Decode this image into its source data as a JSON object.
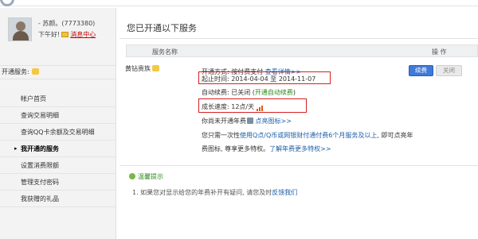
{
  "profile": {
    "username": "- 苏颜。(7773380)",
    "greeting": "下午好!",
    "message_link": "消息中心"
  },
  "sidebar": {
    "services_label": "开通服务:",
    "items": [
      {
        "label": "帐户首页"
      },
      {
        "label": "查询交易明细"
      },
      {
        "label": "查询QQ卡余额及交易明细"
      },
      {
        "label": "我开通的服务",
        "active": true
      },
      {
        "label": "设置消费限额"
      },
      {
        "label": "管理支付密码"
      },
      {
        "label": "我获赠的礼品"
      }
    ]
  },
  "main": {
    "title": "您已开通以下服务",
    "table_headers": {
      "name": "服务名称",
      "action": "操 作"
    },
    "service_name": "黄钻贵族",
    "lines": {
      "pay_method_label": "开通方式: 按付费支付",
      "pay_method_link": "查看详情>>",
      "term_label": "起止时间: 2014-04-04 至 2014-11-07",
      "auto_renew_label": "自动续费: 已关闭 (",
      "auto_renew_link": "开通自动续费",
      "auto_renew_end": ")",
      "growth_label": "成长速度: 12点/天",
      "annual_label": "你尚未开通年费",
      "annual_link": "点亮图标>>",
      "offer_prefix": "您只需一次性",
      "offer_link": "使用Q点/Q币或网银财付通付费6个月服务及以上",
      "offer_suffix": ", 即可点亮年",
      "offer_line2": "费图标, 尊享更多特权。",
      "offer_more_link": "了解年费更多特权>>"
    },
    "buttons": {
      "renew": "续费",
      "close": "关闭"
    },
    "tips": {
      "title": "温馨提示",
      "text_prefix": "1. 如果您对显示给您的年费补开有疑问, 请您及时",
      "text_link": "反馈我们"
    }
  },
  "colors": {
    "highlight_border": "#d62020",
    "renew_button": "#3f7ad8",
    "link": "#1b5eaa",
    "tip_green": "#2b8a1a"
  }
}
